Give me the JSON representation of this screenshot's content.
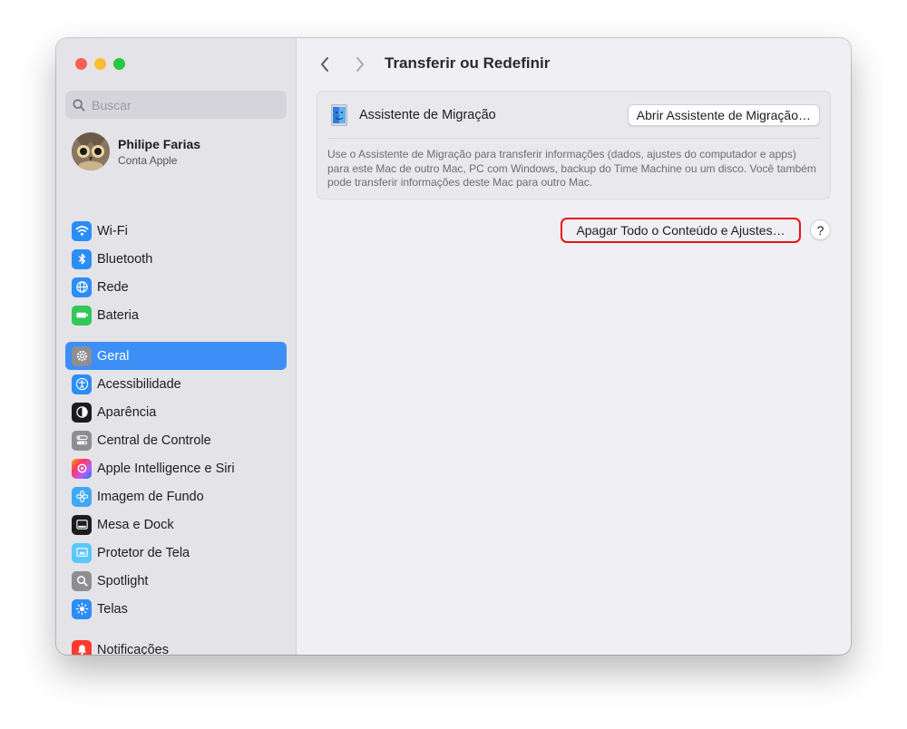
{
  "sidebar": {
    "search_placeholder": "Buscar",
    "account": {
      "name": "Philipe Farias",
      "subtitle": "Conta Apple"
    },
    "group1": [
      {
        "label": "Wi-Fi",
        "icon": "wifi-icon",
        "color": "#2b8df6"
      },
      {
        "label": "Bluetooth",
        "icon": "bluetooth-icon",
        "color": "#2b8df6"
      },
      {
        "label": "Rede",
        "icon": "globe-icon",
        "color": "#2b8df6"
      },
      {
        "label": "Bateria",
        "icon": "battery-icon",
        "color": "#34c759"
      }
    ],
    "group2": [
      {
        "label": "Geral",
        "icon": "gear-icon",
        "color": "#8e8e93",
        "active": true
      },
      {
        "label": "Acessibilidade",
        "icon": "accessibility-icon",
        "color": "#2b8df6"
      },
      {
        "label": "Aparência",
        "icon": "appearance-icon",
        "color": "#1c1c1e"
      },
      {
        "label": "Central de Controle",
        "icon": "control-center-icon",
        "color": "#8e8e93"
      },
      {
        "label": "Apple Intelligence e Siri",
        "icon": "siri-icon",
        "color": "#c86dd7"
      },
      {
        "label": "Imagem de Fundo",
        "icon": "wallpaper-icon",
        "color": "#3fa9f5"
      },
      {
        "label": "Mesa e Dock",
        "icon": "dock-icon",
        "color": "#1c1c1e"
      },
      {
        "label": "Protetor de Tela",
        "icon": "screensaver-icon",
        "color": "#5ac8fa"
      },
      {
        "label": "Spotlight",
        "icon": "spotlight-icon",
        "color": "#8e8e93"
      },
      {
        "label": "Telas",
        "icon": "displays-icon",
        "color": "#2b8df6"
      }
    ],
    "group3": [
      {
        "label": "Notificações",
        "icon": "notifications-icon",
        "color": "#ff3b30"
      }
    ]
  },
  "main": {
    "title": "Transferir ou Redefinir",
    "migration": {
      "label": "Assistente de Migração",
      "button": "Abrir Assistente de Migração…",
      "description": "Use o Assistente de Migração para transferir informações (dados, ajustes do computador e apps) para este Mac de outro Mac, PC com Windows, backup do Time Machine ou um disco. Você também pode transferir informações deste Mac para outro Mac."
    },
    "erase_button": "Apagar Todo o Conteúdo e Ajustes…",
    "help_label": "?"
  },
  "colors": {
    "accent": "#3d8ff7",
    "highlight": "#e8141a"
  }
}
